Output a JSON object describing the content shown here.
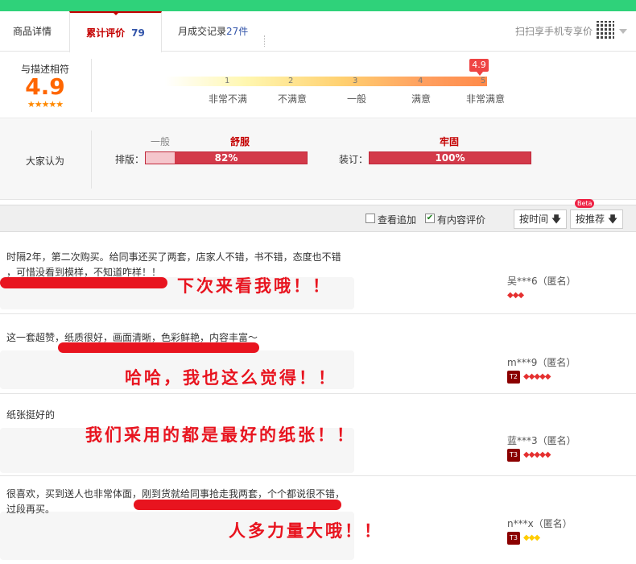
{
  "tabs": [
    {
      "label": "商品详情"
    },
    {
      "label": "累计评价",
      "count": "79"
    },
    {
      "label": "月成交记录",
      "count": "27件"
    }
  ],
  "scan_label": "扫扫享手机专享价",
  "rating": {
    "label": "与描述相符",
    "score": "4.9",
    "stars": "★★★★★",
    "flag": "4.9",
    "scale": [
      "1",
      "2",
      "3",
      "4",
      "5"
    ],
    "scale_labels": [
      "非常不满",
      "不满意",
      "一般",
      "满意",
      "非常满意"
    ]
  },
  "opinion": {
    "label": "大家认为",
    "items": [
      {
        "left": "一般",
        "right": "舒服",
        "name": "排版：",
        "value": "82%",
        "minor_fraction": 0.18
      },
      {
        "right": "牢固",
        "name": "装订：",
        "value": "100%",
        "minor_fraction": 0
      }
    ]
  },
  "filter": {
    "view_append": "查看追加",
    "view_append_checked": false,
    "has_content": "有内容评价",
    "has_content_checked": true,
    "sort_time": "按时间",
    "sort_recommend": "按推荐",
    "beta": "Beta"
  },
  "reviews": [
    {
      "text1": "时隔2年，第二次购买。给同事还买了两套，店家人不错，书不错，态度也不错",
      "text2": "，可惜没看到模样，不知道咋样！！",
      "overlay": "下次来看我哦！！",
      "user": "吴***6（匿名）",
      "hearts": "◆◆◆",
      "badge": ""
    },
    {
      "text1": "这一套超赞，纸质很好，画面清晰，色彩鲜艳，内容丰富～",
      "text2": "",
      "overlay": "哈哈，我也这么觉得！！",
      "user": "m***9（匿名）",
      "hearts": "◆◆◆◆◆",
      "badge": "T2"
    },
    {
      "text1": "纸张挺好的",
      "text2": "",
      "overlay": "我们采用的都是最好的纸张！！",
      "user": "蓝***3（匿名）",
      "hearts": "◆◆◆◆◆",
      "badge": "T3"
    },
    {
      "text1": "很喜欢，买到送人也非常体面，刚到货就给同事抢走我两套，个个都说很不错，",
      "text2": "过段再买。",
      "overlay": "人多力量大哦！！",
      "user": "n***x（匿名）",
      "hearts": "◆◆◆",
      "badge": "T3"
    }
  ],
  "colors": {
    "accent": "#c40000",
    "overlay_red": "#e8141f",
    "top_green": "#2fd27a",
    "score_orange": "#ff6600"
  }
}
